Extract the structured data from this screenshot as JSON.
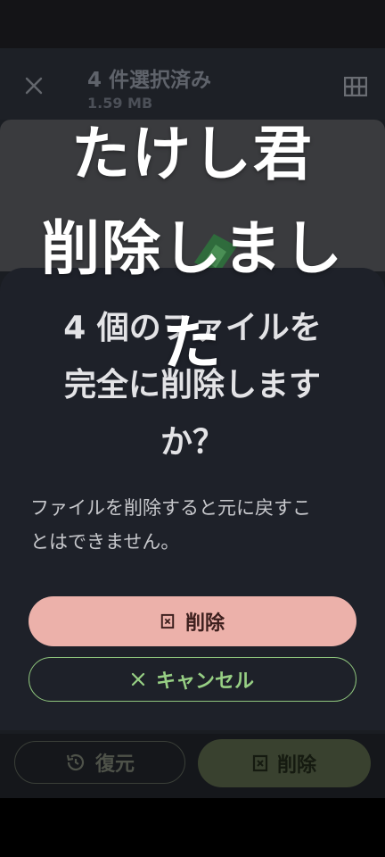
{
  "header": {
    "title": "4 件選択済み",
    "size": "1.59 MB"
  },
  "bottom_bar": {
    "restore_label": "復元",
    "delete_label": "削除"
  },
  "dialog": {
    "title_lines": [
      "4 個のファイルを",
      "完全に削除します",
      "か？"
    ],
    "message_lines": [
      "ファイルを削除すると元に戻すこ",
      "とはできません。"
    ],
    "confirm_label": "削除",
    "cancel_label": "キャンセル"
  },
  "overlay": {
    "lines": [
      "たけし君",
      "削除しまし",
      "た"
    ]
  },
  "icons": {
    "close": "close-icon",
    "grid": "grid-view-icon",
    "restore": "history-icon",
    "delete": "delete-icon",
    "cancel": "x-icon"
  },
  "colors": {
    "accent_green": "#97cf84",
    "danger_pink": "#ecb1aa",
    "dialog_bg": "#1e2129"
  }
}
